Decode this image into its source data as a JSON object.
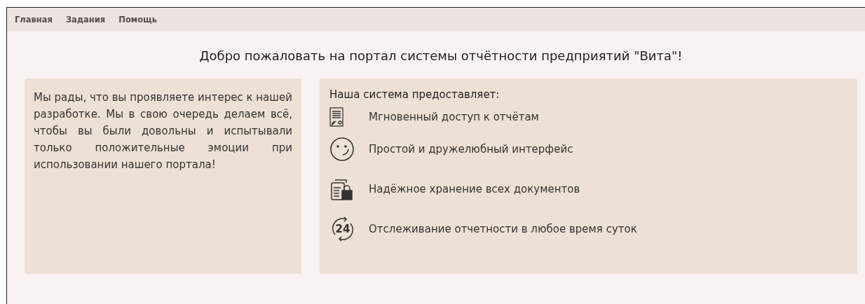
{
  "nav": [
    {
      "label": "Главная"
    },
    {
      "label": "Задания"
    },
    {
      "label": "Помощь"
    }
  ],
  "heading": "Добро пожаловать на портал системы отчётности предприятий \"Вита\"!",
  "intro": "Мы рады, что вы проявляете интерес к нашей разработке. Мы в свою очередь делаем всё, чтобы вы были довольны и испытывали только положительные эмоции при использовании нашего портала!",
  "features_title": "Наша система предоставляет:",
  "features": [
    {
      "kind": "document",
      "text": "Мгновенный доступ к отчётам"
    },
    {
      "kind": "smile",
      "text": "Простой и дружелюбный интерфейс"
    },
    {
      "kind": "lock",
      "text": "Надёжное хранение всех документов"
    },
    {
      "kind": "clock",
      "icon_label": "24",
      "text": "Отслеживание отчетности в любое время суток"
    }
  ]
}
